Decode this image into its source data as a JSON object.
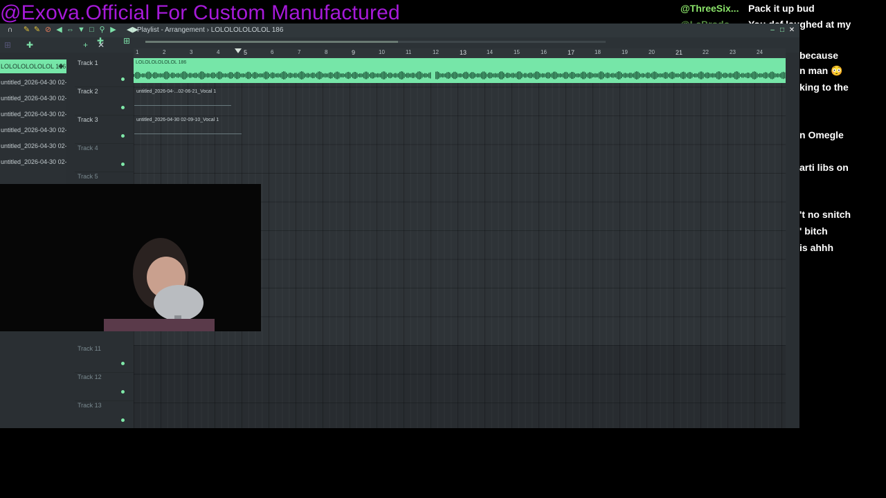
{
  "banner": {
    "text": "@Exova.Official For Custom Manufactured"
  },
  "chat": {
    "messages": [
      {
        "user": "@ThreeSix...",
        "text": "Pack it up bud"
      },
      {
        "user": "@LeBrodo...",
        "text": "You def laughed at my"
      }
    ],
    "fragments": [
      "because",
      "n man 😳",
      "king to the",
      "n Omegle",
      "arti libs on",
      "'t no snitch",
      "' bitch",
      "is ahhh"
    ]
  },
  "fl": {
    "breadcrumb": "Playlist - Arrangement › LOLOLOLOLOLOL 186",
    "toolbar_icons": [
      "magnet-icon",
      "pencil-icon",
      "paint-icon",
      "delete-icon",
      "mute-icon",
      "slip-icon",
      "select-icon",
      "zoom-icon",
      "playback-icon"
    ],
    "ruler": [
      "1",
      "2",
      "3",
      "4",
      "5",
      "6",
      "7",
      "8",
      "9",
      "10",
      "11",
      "12",
      "13",
      "14",
      "15",
      "16",
      "17",
      "18",
      "19",
      "20",
      "21",
      "22",
      "23",
      "24"
    ],
    "picker": [
      {
        "label": "LOLOLOLOLOLOL 186",
        "active": true
      },
      {
        "label": "untitled_2026-04-30 02-...",
        "active": false
      },
      {
        "label": "untitled_2026-04-30 02-...",
        "active": false
      },
      {
        "label": "untitled_2026-04-30 02-...",
        "active": false
      },
      {
        "label": "untitled_2026-04-30 02-...",
        "active": false
      },
      {
        "label": "untitled_2026-04-30 02-...",
        "active": false
      },
      {
        "label": "untitled_2026-04-30 02-...",
        "active": false
      }
    ],
    "tracks": [
      {
        "label": "Track 1"
      },
      {
        "label": "Track 2"
      },
      {
        "label": "Track 3"
      },
      {
        "label": "Track 4"
      },
      {
        "label": "Track 5"
      },
      {
        "label": "Track 11"
      },
      {
        "label": "Track 12"
      },
      {
        "label": "Track 13"
      }
    ],
    "clips": {
      "main": "LOLOLOLOLOLOL 186",
      "vocal1": "untitled_2026-04-...02-06-21_Vocal 1",
      "vocal2": "untitled_2026-04-30 02-09-10_Vocal 1"
    }
  },
  "colors": {
    "banner": "#a61ad9",
    "clip": "#76e6a8",
    "chat_user": "#8be46a"
  }
}
